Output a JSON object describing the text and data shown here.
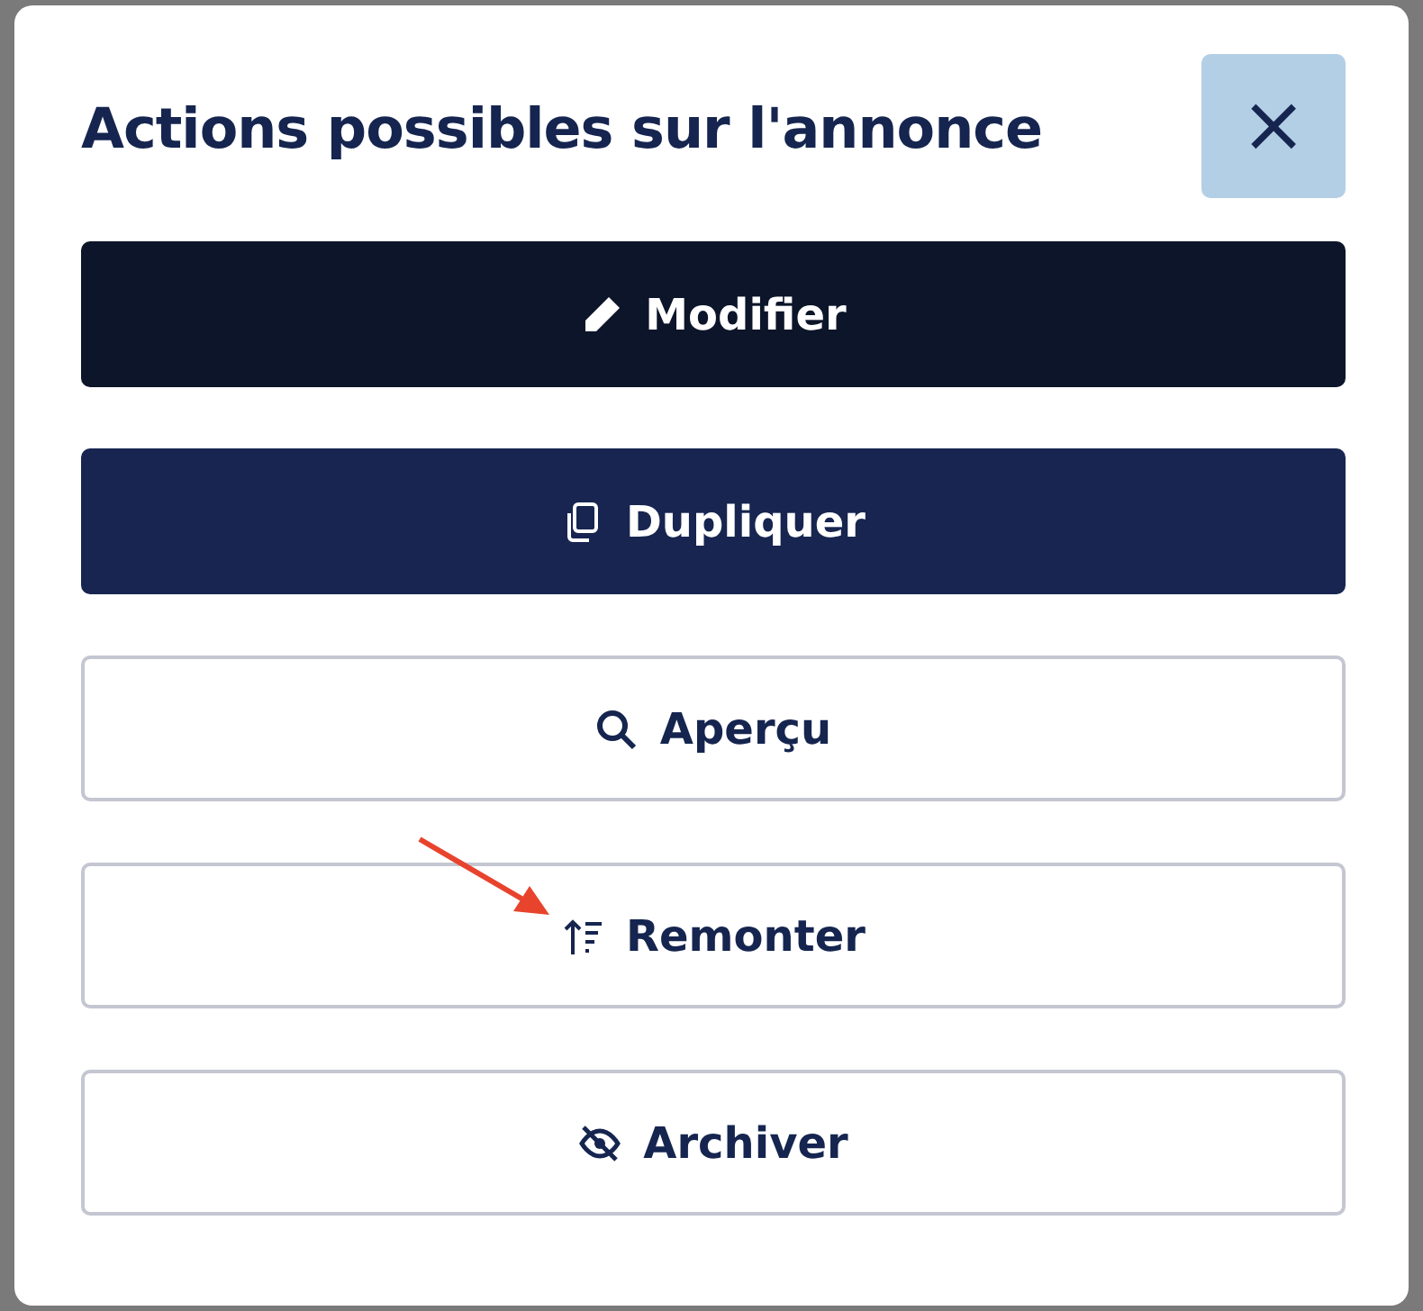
{
  "dialog": {
    "title": "Actions possibles sur l'annonce",
    "close_label": "×"
  },
  "buttons": [
    {
      "label": "Modifier",
      "kind": "dark",
      "highlighted": false
    },
    {
      "label": "Dupliquer",
      "kind": "primary",
      "highlighted": false
    },
    {
      "label": "Aperçu",
      "kind": "outline",
      "highlighted": false
    },
    {
      "label": "Remonter",
      "kind": "outline",
      "highlighted": true
    },
    {
      "label": "Archiver",
      "kind": "outline",
      "highlighted": false
    }
  ]
}
